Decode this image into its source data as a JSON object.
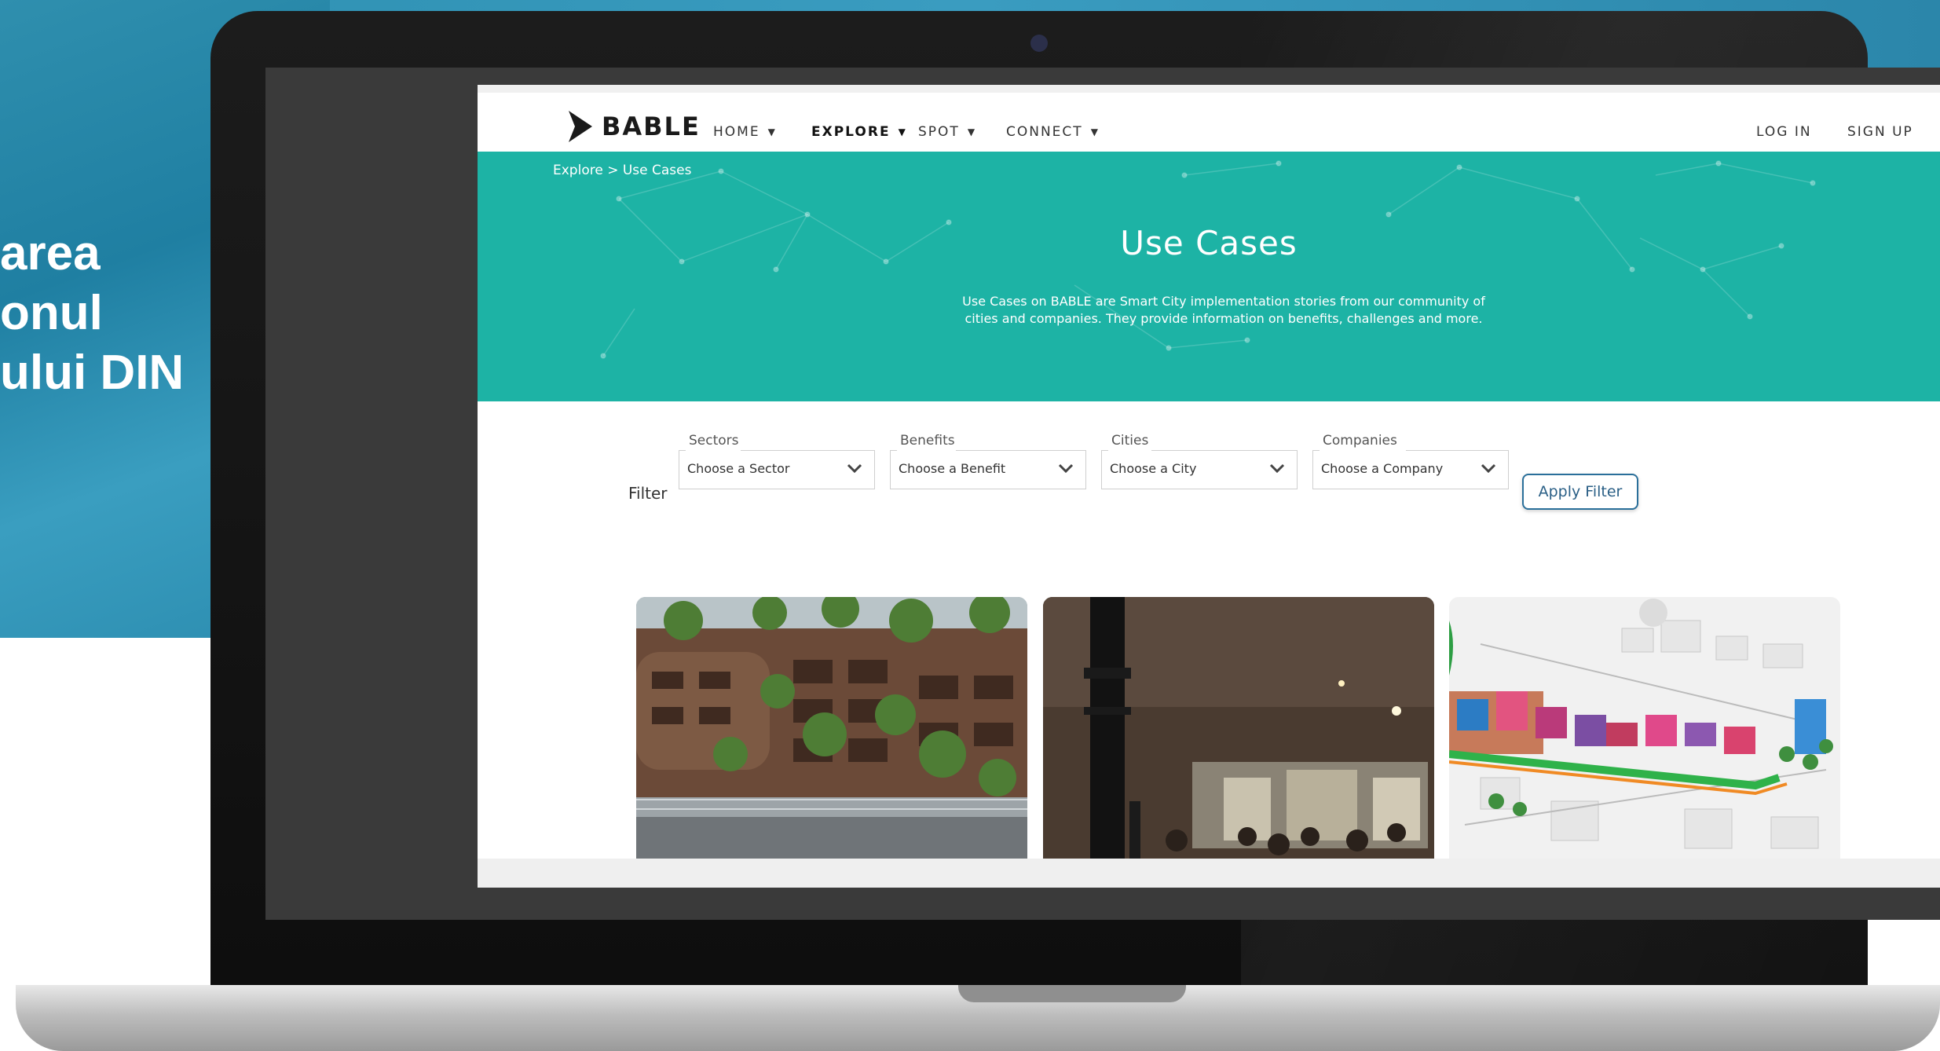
{
  "slide": {
    "text": "area\nonul\nului DIN"
  },
  "site": {
    "logo": "BABLE",
    "nav": [
      {
        "label": "HOME",
        "active": false
      },
      {
        "label": "EXPLORE",
        "active": true
      },
      {
        "label": "SPOT",
        "active": false
      },
      {
        "label": "CONNECT",
        "active": false
      }
    ],
    "auth": {
      "login": "LOG IN",
      "signup": "SIGN UP"
    },
    "breadcrumb": "Explore > Use Cases",
    "hero": {
      "title": "Use Cases",
      "description": "Use Cases on BABLE are Smart City implementation stories from our community of cities and companies. They provide information on benefits, challenges and more."
    },
    "filter": {
      "label": "Filter",
      "fields": [
        {
          "legend": "Sectors",
          "value": "Choose a Sector"
        },
        {
          "legend": "Benefits",
          "value": "Choose a Benefit"
        },
        {
          "legend": "Cities",
          "value": "Choose a City"
        },
        {
          "legend": "Companies",
          "value": "Choose a Company"
        }
      ],
      "apply": "Apply Filter"
    },
    "cards": [
      {
        "image": "green-building-photo"
      },
      {
        "image": "street-lamp-photo"
      },
      {
        "image": "city-illustration"
      }
    ],
    "colors": {
      "accent": "#1db3a5",
      "button_border": "#2a6f9a"
    }
  }
}
